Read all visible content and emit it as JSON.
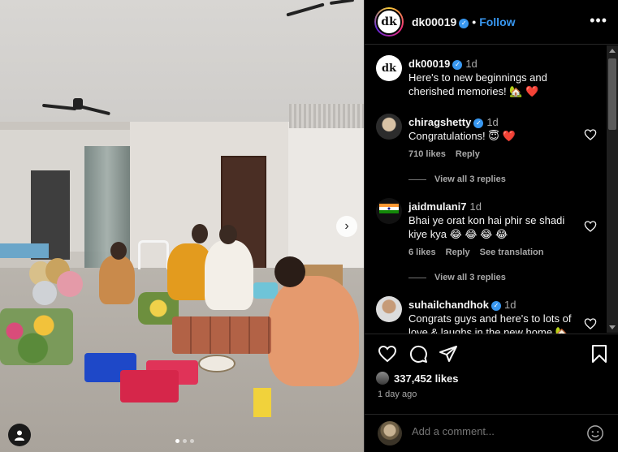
{
  "post": {
    "dots_count": 3,
    "active_dot": 0
  },
  "header": {
    "avatar_text": "dk",
    "username": "dk00019",
    "separator": "•",
    "follow_label": "Follow",
    "more_label": "•••"
  },
  "caption": {
    "avatar_text": "dk",
    "username": "dk00019",
    "time": "1d",
    "text": "Here's to new beginnings and cherished memories! 🏡 ❤️"
  },
  "comments": [
    {
      "username": "chiragshetty",
      "verified": true,
      "time": "1d",
      "text": "Congratulations! 😇 ❤️",
      "likes": "710 likes",
      "reply_label": "Reply",
      "view_replies": "View all 3 replies"
    },
    {
      "username": "jaidmulani7",
      "verified": false,
      "time": "1d",
      "text": "Bhai ye orat kon hai phir se shadi kiye kya 😂 😂 😂 😂",
      "likes": "6 likes",
      "reply_label": "Reply",
      "see_translation": "See translation",
      "view_replies": "View all 3 replies"
    },
    {
      "username": "suhailchandhok",
      "verified": true,
      "time": "1d",
      "text": "Congrats guys and here's to lots of love & laughs in the new home 🏡"
    }
  ],
  "actions": {
    "likes_count": "337,452 likes",
    "date": "1 day ago"
  },
  "add_comment": {
    "placeholder": "Add a comment..."
  },
  "colors": {
    "accent": "#3897f0",
    "heart_red": "#ff3040",
    "background": "#000000",
    "secondary_text": "#a8a8a8"
  },
  "icons": [
    "ceiling-fan-icon",
    "chevron-right-icon",
    "user-tag-icon",
    "verified-icon",
    "heart-icon",
    "comment-icon",
    "share-icon",
    "bookmark-icon",
    "emoji-icon",
    "more-icon"
  ]
}
